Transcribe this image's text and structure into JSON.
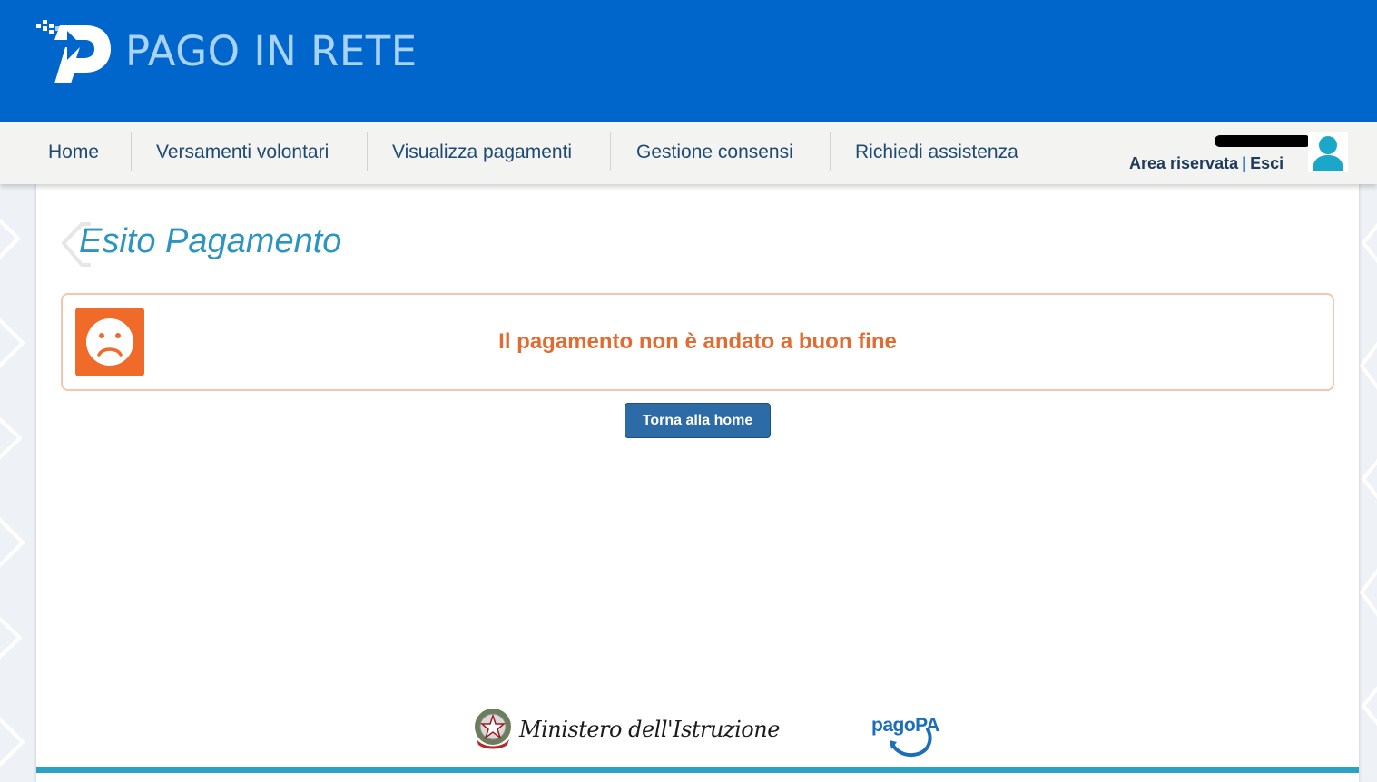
{
  "header": {
    "brand_text": "PAGO IN RETE",
    "logo_icon": "pago-in-rete-p-logo",
    "background_color": "#0066cc"
  },
  "nav": {
    "items": [
      {
        "label": "Home"
      },
      {
        "label": "Versamenti volontari"
      },
      {
        "label": "Visualizza pagamenti"
      },
      {
        "label": "Gestione consensi"
      },
      {
        "label": "Richiedi assistenza"
      }
    ]
  },
  "user": {
    "area_label": "Area riservata",
    "separator": "|",
    "logout_label": "Esci",
    "avatar_icon": "user-icon"
  },
  "main": {
    "title": "Esito Pagamento",
    "alert": {
      "icon": "sad-face-icon",
      "message": "Il pagamento non è andato a buon fine",
      "color": "#e06c32"
    },
    "home_button_label": "Torna alla home"
  },
  "footer": {
    "ministry_label": "Ministero dell'Istruzione",
    "ministry_icon": "italian-republic-emblem-icon",
    "pagopa_label": "pagoPA",
    "accent_color": "#2aa2c2"
  }
}
